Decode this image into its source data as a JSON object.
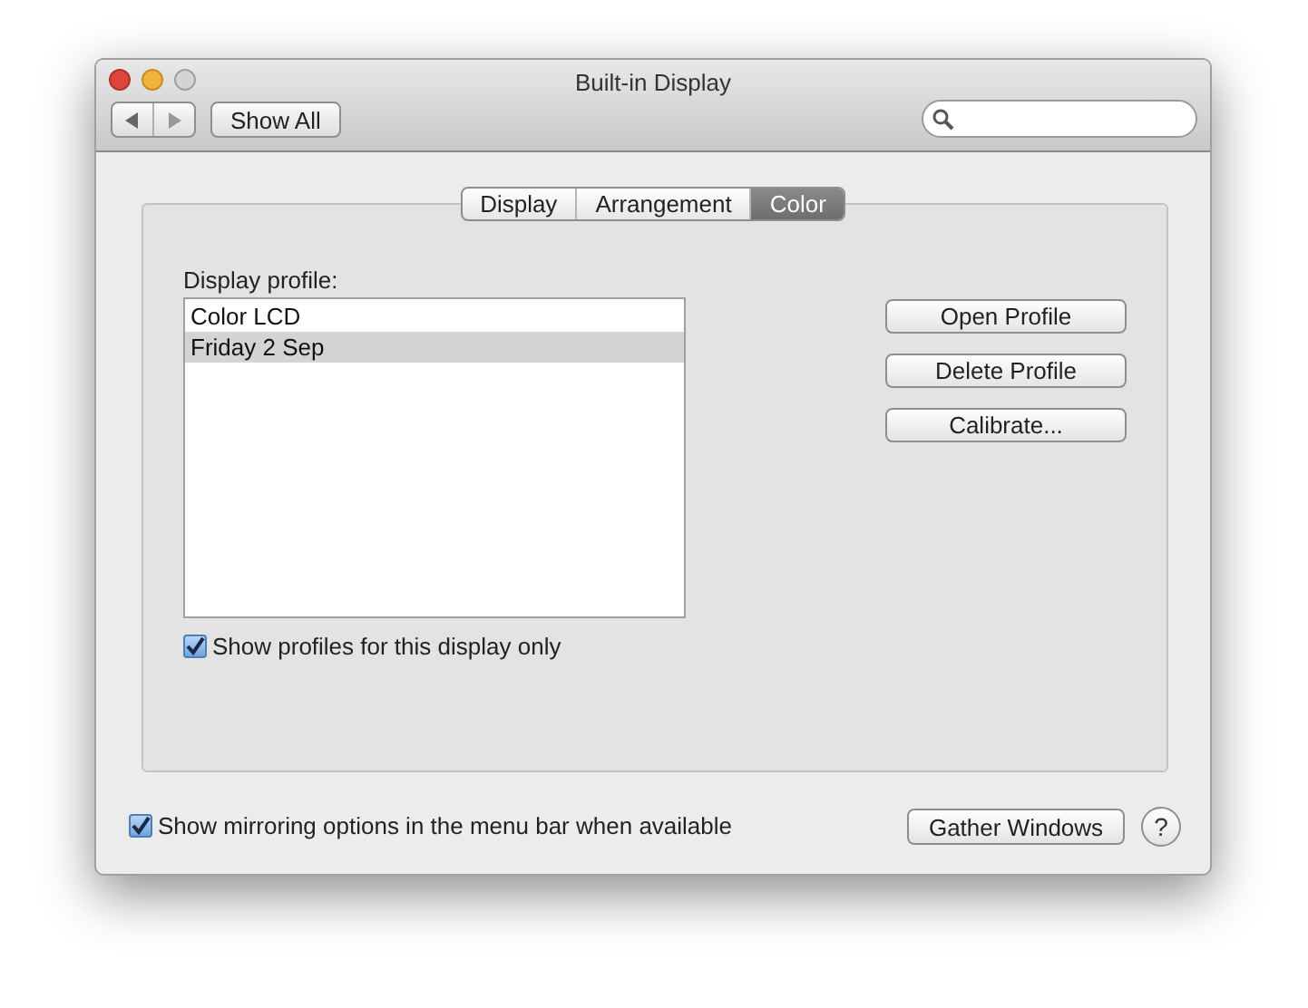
{
  "window": {
    "title": "Built-in Display"
  },
  "toolbar": {
    "show_all": "Show All"
  },
  "tabs": [
    {
      "label": "Display",
      "selected": false
    },
    {
      "label": "Arrangement",
      "selected": false
    },
    {
      "label": "Color",
      "selected": true
    }
  ],
  "profile_label": "Display profile:",
  "profiles": [
    {
      "name": "Color LCD",
      "selected": false
    },
    {
      "name": "Friday 2 Sep",
      "selected": true
    }
  ],
  "buttons": [
    "Open Profile",
    "Delete Profile",
    "Calibrate..."
  ],
  "show_profiles": {
    "label": "Show profiles for this display only",
    "checked": true
  },
  "mirroring": {
    "label": "Show mirroring options in the menu bar when available",
    "checked": true
  },
  "gather_button": "Gather Windows",
  "help_button": "?"
}
